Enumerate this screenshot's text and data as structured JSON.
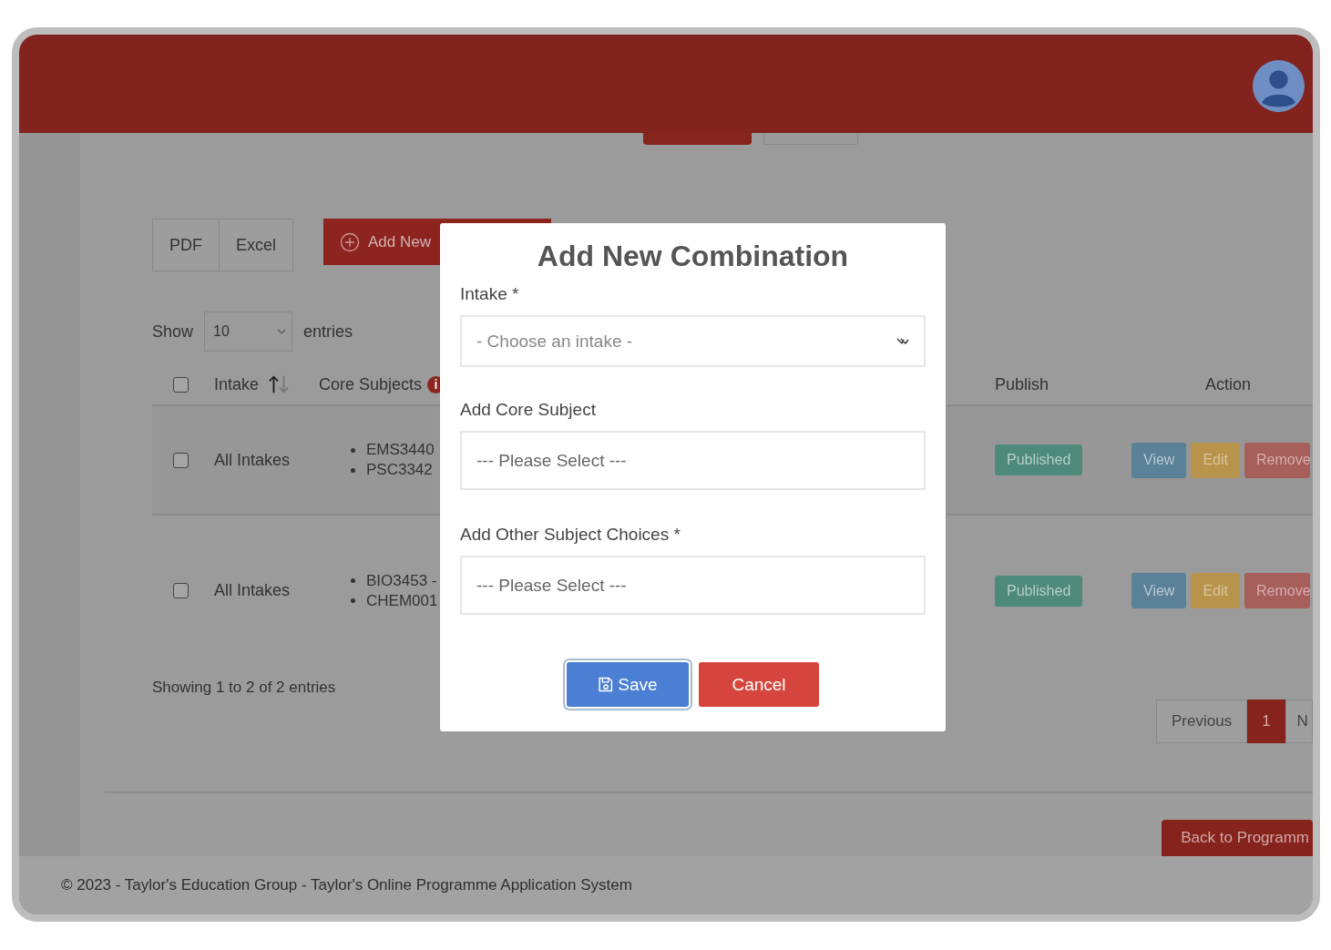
{
  "header": {
    "tabs": [
      {
        "kind": "primary"
      },
      {
        "kind": "outline"
      }
    ]
  },
  "toolbar": {
    "export_buttons": [
      "PDF",
      "Excel"
    ],
    "add_button": "Add New"
  },
  "length": {
    "show": "Show",
    "value": "10",
    "entries": "entries"
  },
  "table": {
    "header_checkbox": {
      "checked": false
    },
    "columns": [
      {
        "kind": "sort",
        "label": "Intake"
      },
      {
        "kind": "info",
        "label": "Core Subjects",
        "badge": "i"
      },
      {
        "kind": "text",
        "label": "Publish"
      },
      {
        "kind": "text",
        "label": "Action"
      }
    ],
    "rows": [
      {
        "checked": false,
        "intake": "All Intakes",
        "core_subjects": [
          "EMS3440",
          "PSC3342"
        ],
        "publish": "Published",
        "actions": [
          "View",
          "Edit",
          "Remove"
        ]
      },
      {
        "checked": false,
        "intake": "All Intakes",
        "core_subjects": [
          "BIO3453 -",
          "CHEM001"
        ],
        "publish": "Published",
        "actions": [
          "View",
          "Edit",
          "Remove"
        ]
      }
    ]
  },
  "info": "Showing 1 to 2 of 2 entries",
  "pagination": [
    {
      "label": "Previous",
      "selected": false
    },
    {
      "label": "1",
      "selected": true
    },
    {
      "label": "N",
      "selected": false
    }
  ],
  "back_button": "Back to Programm",
  "footer": "© 2023 - Taylor's Education Group - Taylor's Online Programme Application System",
  "modal": {
    "title": "Add New Combination",
    "fields": [
      {
        "label": "Intake *",
        "kind": "select",
        "placeholder": "- Choose an intake -"
      },
      {
        "label": "Add Core Subject",
        "kind": "input",
        "placeholder": "--- Please Select ---"
      },
      {
        "label": "Add Other Subject Choices *",
        "kind": "input",
        "placeholder": "--- Please Select ---"
      }
    ],
    "buttons": [
      {
        "label": "Save",
        "kind": "primary",
        "focused": true
      },
      {
        "label": "Cancel",
        "kind": "danger",
        "focused": false
      }
    ]
  }
}
